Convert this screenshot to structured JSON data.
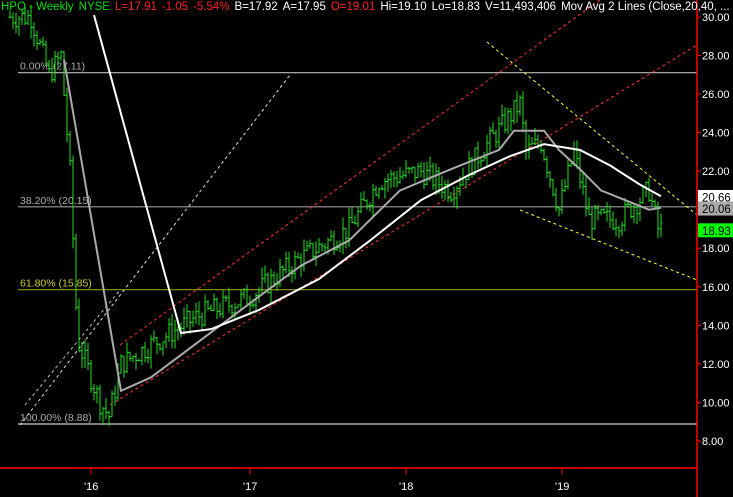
{
  "header": {
    "symbol": "HPQ - Weekly",
    "exchange": "NYSE",
    "last": "L=17.91",
    "change": "-1.05",
    "pct": "-5.54%",
    "bid": "B=17.92",
    "ask": "A=17.95",
    "open": "O=19.01",
    "high": "Hi=19.10",
    "low": "Lo=18.83",
    "volume": "V=11,493,406",
    "study": "Mov Avg 2 Lines (Close,20,40, ..."
  },
  "colors": {
    "up": "#22dd22",
    "price": "#00ff00",
    "neg": "#ff2020",
    "ma20": "#aaaaaa",
    "ma40": "#ffffff",
    "axis": "#ff0000",
    "fib618": "#999900",
    "trend_red": "#ff3333",
    "trend_yellow": "#ffff33"
  },
  "chart_data": {
    "type": "ohlc",
    "ylim": [
      7,
      31
    ],
    "y_ticks": [
      "30.00",
      "28.00",
      "26.00",
      "24.00",
      "22.00",
      "20.00",
      "18.00",
      "16.00",
      "14.00",
      "12.00",
      "10.00",
      "8.00"
    ],
    "x_ticks": [
      {
        "label": "'16",
        "week": 27
      },
      {
        "label": "'17",
        "week": 80
      },
      {
        "label": "'18",
        "week": 132
      },
      {
        "label": "'19",
        "week": 184
      }
    ],
    "weeks": 218,
    "price_path": [
      [
        0,
        30
      ],
      [
        7,
        30
      ],
      [
        13,
        27
      ],
      [
        17,
        28
      ],
      [
        20,
        22
      ],
      [
        22,
        15
      ],
      [
        23,
        13
      ],
      [
        30,
        10
      ],
      [
        33,
        9.3
      ],
      [
        37,
        12
      ],
      [
        47,
        13
      ],
      [
        63,
        14.5
      ],
      [
        80,
        15.5
      ],
      [
        97,
        17.5
      ],
      [
        113,
        19
      ],
      [
        123,
        21.5
      ],
      [
        137,
        22
      ],
      [
        147,
        21
      ],
      [
        157,
        23
      ],
      [
        170,
        25.5
      ],
      [
        172,
        23
      ],
      [
        177,
        23.5
      ],
      [
        183,
        20
      ],
      [
        188,
        23
      ],
      [
        193,
        19.5
      ],
      [
        203,
        19.5
      ],
      [
        213,
        21
      ],
      [
        216,
        19
      ]
    ],
    "ma20": [
      [
        18,
        27.8
      ],
      [
        37,
        10.6
      ],
      [
        47,
        11.3
      ],
      [
        77,
        14.8
      ],
      [
        97,
        17.1
      ],
      [
        113,
        18.4
      ],
      [
        130,
        21.0
      ],
      [
        147,
        22.1
      ],
      [
        163,
        23.1
      ],
      [
        168,
        24.1
      ],
      [
        178,
        24.1
      ],
      [
        183,
        23.1
      ],
      [
        190,
        22.1
      ],
      [
        197,
        21.0
      ],
      [
        205,
        20.5
      ],
      [
        213,
        20.0
      ],
      [
        217,
        20.1
      ]
    ],
    "ma40": [
      [
        28,
        30.1
      ],
      [
        57,
        13.6
      ],
      [
        67,
        13.8
      ],
      [
        83,
        14.8
      ],
      [
        103,
        16.4
      ],
      [
        120,
        18.4
      ],
      [
        137,
        20.5
      ],
      [
        153,
        21.8
      ],
      [
        167,
        22.8
      ],
      [
        178,
        23.4
      ],
      [
        190,
        23.1
      ],
      [
        200,
        22.3
      ],
      [
        210,
        21.3
      ],
      [
        217,
        20.7
      ]
    ],
    "fib": [
      {
        "label": "0.00% (27.11)",
        "price": 27.11
      },
      {
        "label": "38.20% (20.15)",
        "price": 20.15
      },
      {
        "label": "61.80% (15.85)",
        "price": 15.85
      },
      {
        "label": "100.00% (8.88)",
        "price": 8.88
      }
    ],
    "price_labels": [
      {
        "text": "20.66",
        "price": 20.66,
        "bg": "#ffffff"
      },
      {
        "text": "20.06",
        "price": 20.06,
        "bg": "#aaaaaa"
      },
      {
        "text": "18.93",
        "price": 18.93,
        "bg": "#00ff00"
      }
    ]
  }
}
